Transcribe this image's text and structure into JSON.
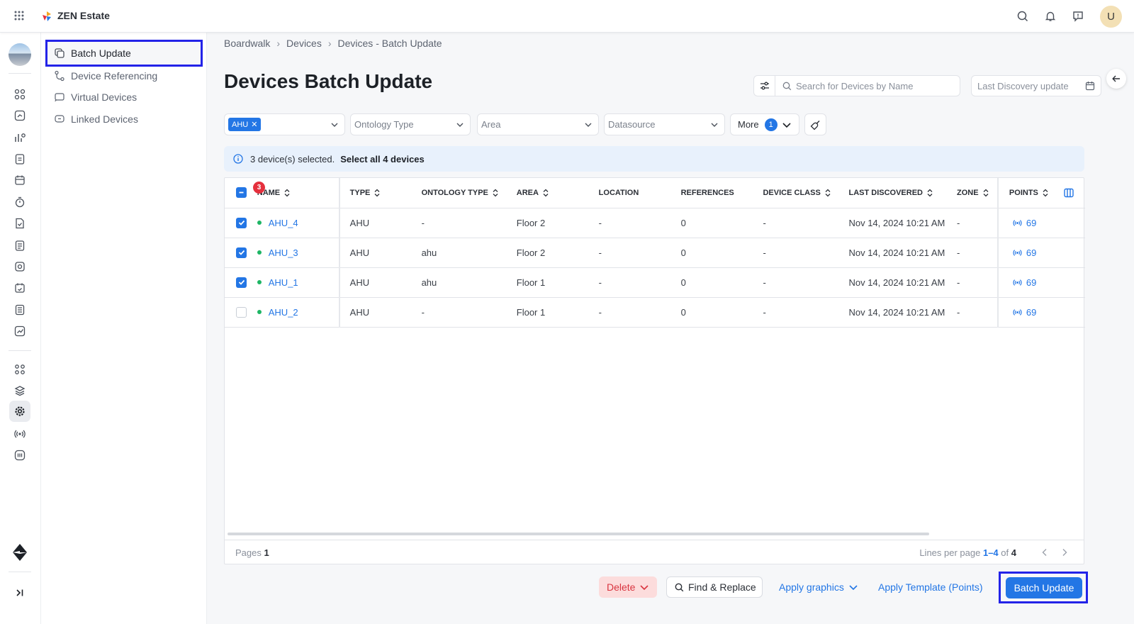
{
  "app": {
    "title": "ZEN Estate",
    "avatar_initial": "U"
  },
  "subnav": {
    "items": [
      {
        "label": "Batch Update",
        "icon": "batch-update-icon",
        "active": true
      },
      {
        "label": "Device Referencing",
        "icon": "referencing-icon",
        "active": false
      },
      {
        "label": "Virtual Devices",
        "icon": "virtual-devices-icon",
        "active": false
      },
      {
        "label": "Linked Devices",
        "icon": "linked-devices-icon",
        "active": false
      }
    ]
  },
  "breadcrumb": [
    "Boardwalk",
    "Devices",
    "Devices - Batch Update"
  ],
  "page": {
    "title": "Devices Batch Update"
  },
  "search": {
    "placeholder": "Search for Devices by Name"
  },
  "date_field": {
    "placeholder": "Last Discovery update"
  },
  "filters": {
    "type_chip": "AHU",
    "ontology_type": "Ontology Type",
    "area": "Area",
    "datasource": "Datasource",
    "more_label": "More",
    "more_count": "1"
  },
  "selection": {
    "text": "3 device(s) selected.",
    "select_all": "Select all 4 devices",
    "selected_count": "3"
  },
  "table": {
    "columns": [
      "NAME",
      "TYPE",
      "ONTOLOGY TYPE",
      "AREA",
      "LOCATION",
      "REFERENCES",
      "DEVICE CLASS",
      "LAST DISCOVERED",
      "ZONE",
      "POINTS"
    ],
    "rows": [
      {
        "checked": true,
        "name": "AHU_4",
        "type": "AHU",
        "ontology_type": "-",
        "area": "Floor 2",
        "location": "-",
        "references": "0",
        "device_class": "-",
        "last_discovered": "Nov 14, 2024 10:21 AM",
        "zone": "-",
        "points": "69"
      },
      {
        "checked": true,
        "name": "AHU_3",
        "type": "AHU",
        "ontology_type": "ahu",
        "area": "Floor 2",
        "location": "-",
        "references": "0",
        "device_class": "-",
        "last_discovered": "Nov 14, 2024 10:21 AM",
        "zone": "-",
        "points": "69"
      },
      {
        "checked": true,
        "name": "AHU_1",
        "type": "AHU",
        "ontology_type": "ahu",
        "area": "Floor 1",
        "location": "-",
        "references": "0",
        "device_class": "-",
        "last_discovered": "Nov 14, 2024 10:21 AM",
        "zone": "-",
        "points": "69"
      },
      {
        "checked": false,
        "name": "AHU_2",
        "type": "AHU",
        "ontology_type": "-",
        "area": "Floor 1",
        "location": "-",
        "references": "0",
        "device_class": "-",
        "last_discovered": "Nov 14, 2024 10:21 AM",
        "zone": "-",
        "points": "69"
      }
    ]
  },
  "pagination": {
    "pages_label": "Pages",
    "pages": "1",
    "lines_label": "Lines per page",
    "range": "1–4",
    "of_label": "of",
    "total": "4"
  },
  "actions": {
    "delete": "Delete",
    "find_replace": "Find & Replace",
    "apply_graphics": "Apply graphics",
    "apply_template": "Apply Template (Points)",
    "batch_update": "Batch Update"
  },
  "colors": {
    "accent": "#2376e5",
    "danger": "#e5303d",
    "online": "#1eb564",
    "highlight": "#2323e8"
  }
}
